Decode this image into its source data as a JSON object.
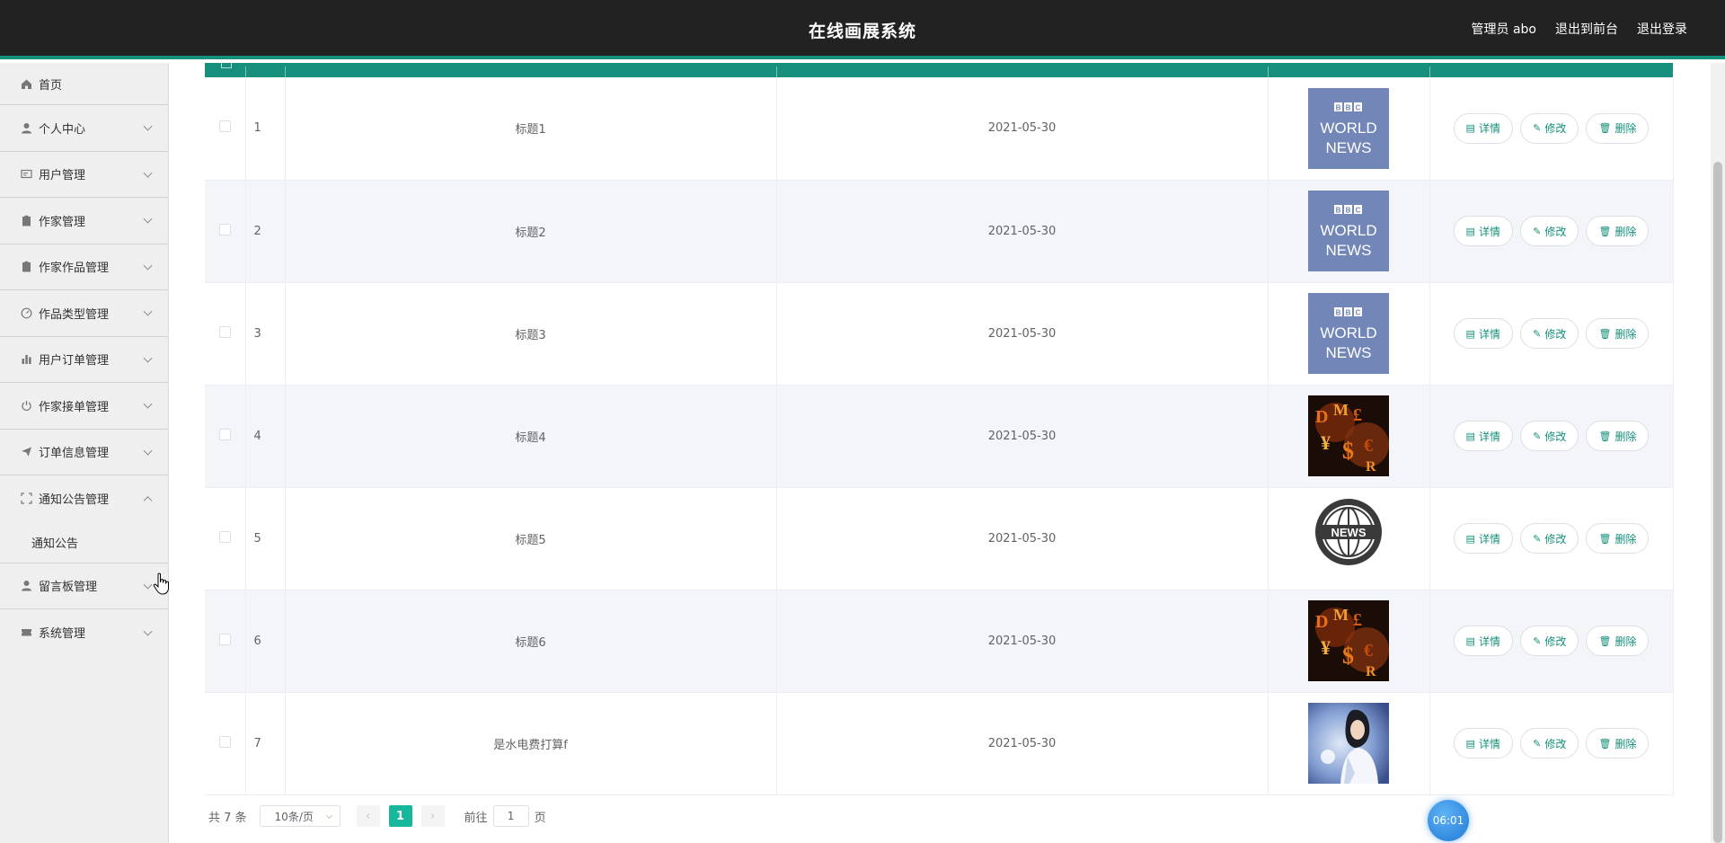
{
  "header": {
    "title": "在线画展系统",
    "user_label": "管理员 abo",
    "front_label": "退出到前台",
    "logout_label": "退出登录"
  },
  "sidebar": {
    "items": [
      {
        "label": "首页",
        "icon": "home-icon"
      },
      {
        "label": "个人中心",
        "icon": "user-icon"
      },
      {
        "label": "用户管理",
        "icon": "id-card-icon"
      },
      {
        "label": "作家管理",
        "icon": "clipboard-icon"
      },
      {
        "label": "作家作品管理",
        "icon": "clipboard-icon"
      },
      {
        "label": "作品类型管理",
        "icon": "gauge-icon"
      },
      {
        "label": "用户订单管理",
        "icon": "bar-chart-icon"
      },
      {
        "label": "作家接单管理",
        "icon": "power-icon"
      },
      {
        "label": "订单信息管理",
        "icon": "send-icon"
      },
      {
        "label": "通知公告管理",
        "icon": "fullscreen-icon"
      },
      {
        "label": "留言板管理",
        "icon": "user-icon"
      },
      {
        "label": "系统管理",
        "icon": "ticket-icon"
      }
    ],
    "submenu_notice": "通知公告"
  },
  "table": {
    "rows": [
      {
        "index": "1",
        "title": "标题1",
        "date": "2021-05-30",
        "image": "bbc-world-news"
      },
      {
        "index": "2",
        "title": "标题2",
        "date": "2021-05-30",
        "image": "bbc-world-news"
      },
      {
        "index": "3",
        "title": "标题3",
        "date": "2021-05-30",
        "image": "bbc-world-news"
      },
      {
        "index": "4",
        "title": "标题4",
        "date": "2021-05-30",
        "image": "currency-symbols"
      },
      {
        "index": "5",
        "title": "标题5",
        "date": "2021-05-30",
        "image": "news-globe"
      },
      {
        "index": "6",
        "title": "标题6",
        "date": "2021-05-30",
        "image": "currency-symbols"
      },
      {
        "index": "7",
        "title": "是水电费打算f",
        "date": "2021-05-30",
        "image": "portrait-photo"
      }
    ],
    "actions": {
      "detail": "详情",
      "edit": "修改",
      "delete": "删除"
    }
  },
  "pagination": {
    "total": "共 7 条",
    "page_size": "10条/页",
    "current_page": "1",
    "goto_prefix": "前往",
    "goto_value": "1",
    "goto_suffix": "页"
  },
  "timer": "06:01",
  "colors": {
    "header_bg": "#222222",
    "accent": "#16907c",
    "pager_active": "#16b79a"
  }
}
